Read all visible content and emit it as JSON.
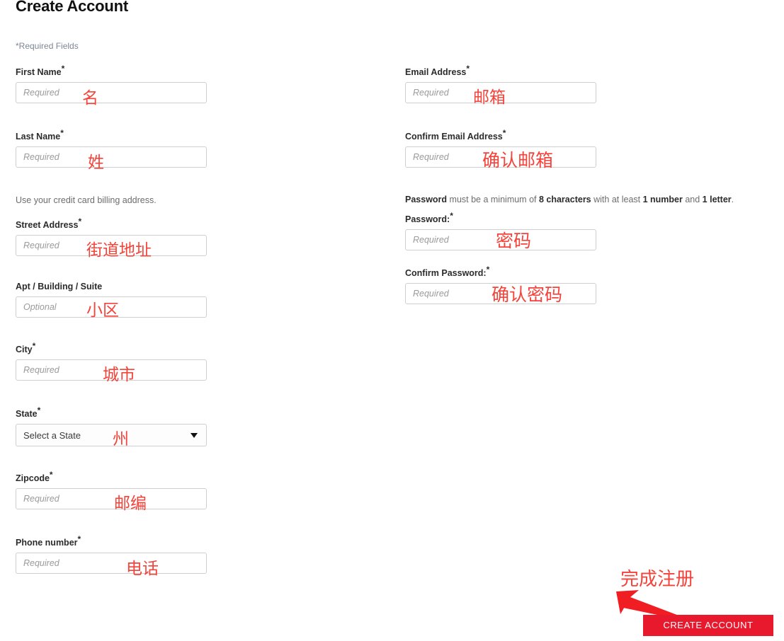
{
  "page": {
    "title": "Create Account",
    "required_note": "*Required Fields"
  },
  "left_column": {
    "fields": [
      {
        "label": "First Name",
        "required": true,
        "placeholder": "Required",
        "annotation": "名"
      },
      {
        "label": "Last Name",
        "required": true,
        "placeholder": "Required",
        "annotation": "姓"
      },
      {
        "label": "Street Address",
        "required": true,
        "placeholder": "Required",
        "annotation": "街道地址"
      },
      {
        "label": "Apt / Building / Suite",
        "required": false,
        "placeholder": "Optional",
        "annotation": "小区"
      },
      {
        "label": "City",
        "required": true,
        "placeholder": "Required",
        "annotation": "城市"
      },
      {
        "label": "State",
        "required": true,
        "placeholder": "Select a State",
        "annotation": "州"
      },
      {
        "label": "Zipcode",
        "required": true,
        "placeholder": "Required",
        "annotation": "邮编"
      },
      {
        "label": "Phone number",
        "required": true,
        "placeholder": "Required",
        "annotation": "电话"
      }
    ],
    "billing_helper": "Use your credit card billing address."
  },
  "right_column": {
    "fields": [
      {
        "label": "Email Address",
        "required": true,
        "placeholder": "Required",
        "annotation": "邮箱"
      },
      {
        "label": "Confirm Email Address",
        "required": true,
        "placeholder": "Required",
        "annotation": "确认邮箱"
      },
      {
        "label": "Password:",
        "required": true,
        "placeholder": "Required",
        "annotation": "密码"
      },
      {
        "label": "Confirm Password:",
        "required": true,
        "placeholder": "Required",
        "annotation": "确认密码"
      }
    ],
    "password_rule": {
      "p1": "Password",
      "p2": " must be a minimum of ",
      "p3": "8 characters",
      "p4": " with at least ",
      "p5": "1 number",
      "p6": " and ",
      "p7": "1 letter",
      "p8": "."
    }
  },
  "submit": {
    "label": "CREATE ACCOUNT",
    "annotation": "完成注册",
    "color": "#e8192c"
  },
  "annotation_color": "#f4433a"
}
